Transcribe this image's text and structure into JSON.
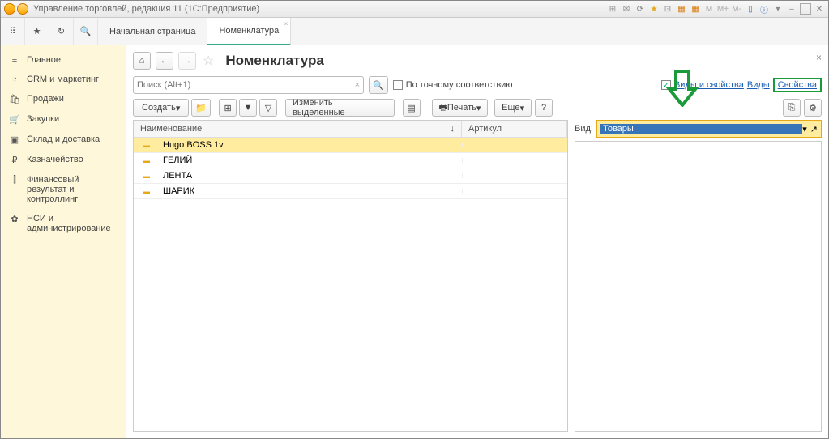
{
  "window_title": "Управление торговлей, редакция 11  (1С:Предприятие)",
  "tabs": {
    "home": "Начальная страница",
    "nomenclature": "Номенклатура"
  },
  "page_title": "Номенклатура",
  "search_placeholder": "Поиск (Alt+1)",
  "exact_match": "По точному соответствию",
  "links": {
    "types_and_props": "Виды и свойства",
    "types": "Виды",
    "props": "Свойства"
  },
  "toolbar": {
    "create": "Создать",
    "change_selected": "Изменить выделенные",
    "print": "Печать",
    "more": "Еще"
  },
  "right": {
    "label": "Вид:",
    "value": "Товары"
  },
  "columns": {
    "name": "Наименование",
    "article": "Артикул"
  },
  "rows": [
    {
      "name": "Hugo BOSS 1v"
    },
    {
      "name": "ГЕЛИЙ"
    },
    {
      "name": "ЛЕНТА"
    },
    {
      "name": "ШАРИК"
    }
  ],
  "sidebar": [
    {
      "icon": "≡",
      "label": "Главное"
    },
    {
      "icon": "◔",
      "label": "CRM и маркетинг"
    },
    {
      "icon": "🛍",
      "label": "Продажи"
    },
    {
      "icon": "🛒",
      "label": "Закупки"
    },
    {
      "icon": "▣",
      "label": "Склад и доставка"
    },
    {
      "icon": "₽",
      "label": "Казначейство"
    },
    {
      "icon": "⫿",
      "label": "Финансовый результат и контроллинг"
    },
    {
      "icon": "✿",
      "label": "НСИ и администрирование"
    }
  ]
}
